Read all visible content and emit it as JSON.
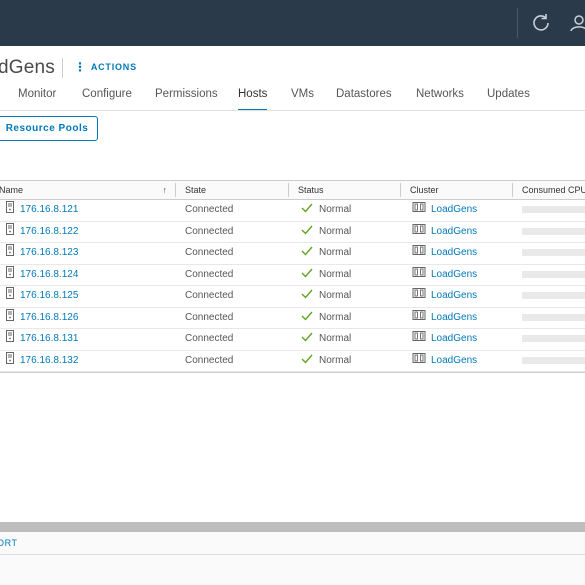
{
  "header": {
    "title": "dGens",
    "actions_label": "ACTIONS"
  },
  "topbar": {
    "icons": [
      "refresh-icon",
      "user-icon"
    ]
  },
  "tabs": [
    {
      "label": "Monitor",
      "active": false
    },
    {
      "label": "Configure",
      "active": false
    },
    {
      "label": "Permissions",
      "active": false
    },
    {
      "label": "Hosts",
      "active": true
    },
    {
      "label": "VMs",
      "active": false
    },
    {
      "label": "Datastores",
      "active": false
    },
    {
      "label": "Networks",
      "active": false
    },
    {
      "label": "Updates",
      "active": false
    }
  ],
  "subtabs": {
    "resource_pools_label": "Resource Pools"
  },
  "table": {
    "columns": [
      "Name",
      "State",
      "Status",
      "Cluster",
      "Consumed CPU"
    ],
    "sort_column": "Name",
    "sort_direction": "ascending",
    "rows": [
      {
        "name": "176.16.8.121",
        "state": "Connected",
        "status": "Normal",
        "cluster": "LoadGens"
      },
      {
        "name": "176.16.8.122",
        "state": "Connected",
        "status": "Normal",
        "cluster": "LoadGens"
      },
      {
        "name": "176.16.8.123",
        "state": "Connected",
        "status": "Normal",
        "cluster": "LoadGens"
      },
      {
        "name": "176.16.8.124",
        "state": "Connected",
        "status": "Normal",
        "cluster": "LoadGens"
      },
      {
        "name": "176.16.8.125",
        "state": "Connected",
        "status": "Normal",
        "cluster": "LoadGens"
      },
      {
        "name": "176.16.8.126",
        "state": "Connected",
        "status": "Normal",
        "cluster": "LoadGens"
      },
      {
        "name": "176.16.8.131",
        "state": "Connected",
        "status": "Normal",
        "cluster": "LoadGens"
      },
      {
        "name": "176.16.8.132",
        "state": "Connected",
        "status": "Normal",
        "cluster": "LoadGens"
      }
    ]
  },
  "footer": {
    "export_label": "ORT"
  },
  "colors": {
    "topbar": "#2b3a4a",
    "accent": "#0079b8",
    "status_ok": "#62a420"
  }
}
